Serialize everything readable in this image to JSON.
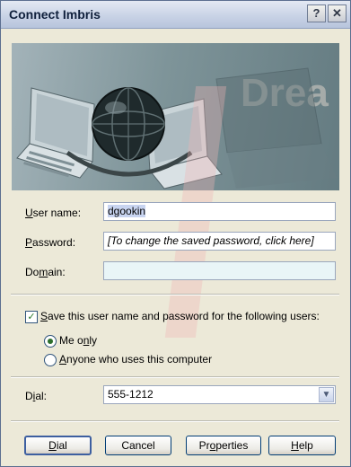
{
  "window": {
    "title": "Connect Imbris",
    "help_glyph": "?",
    "close_glyph": "✕"
  },
  "banner": {
    "watermark_text": "Drea"
  },
  "form": {
    "username": {
      "label_access": "U",
      "label_rest": "ser name:",
      "value": "dgookin"
    },
    "password": {
      "label_access": "P",
      "label_rest": "assword:",
      "placeholder": "[To change the saved password, click here]"
    },
    "domain": {
      "label_pre": "Do",
      "label_access": "m",
      "label_rest": "ain:",
      "value": ""
    }
  },
  "save": {
    "checked": true,
    "check_glyph": "✓",
    "label_access": "S",
    "label_rest": "ave this user name and password for the following users:",
    "options": [
      {
        "label_pre": "Me o",
        "label_access": "n",
        "label_rest": "ly",
        "selected": true
      },
      {
        "label_pre": "",
        "label_access": "A",
        "label_rest": "nyone who uses this computer",
        "selected": false
      }
    ]
  },
  "dial": {
    "label_pre": "D",
    "label_access": "i",
    "label_rest": "al:",
    "value": "555-1212",
    "arrow_glyph": "▼"
  },
  "buttons": {
    "dial": {
      "label_access": "D",
      "label_rest": "ial"
    },
    "cancel": {
      "label": "Cancel"
    },
    "properties": {
      "label_pre": "Pr",
      "label_access": "o",
      "label_rest": "perties"
    },
    "help": {
      "label_access": "H",
      "label_rest": "elp"
    }
  },
  "colors": {
    "titlebar_text": "#10203c",
    "window_bg": "#ece9d8",
    "field_highlight": "#e9f5f7"
  }
}
